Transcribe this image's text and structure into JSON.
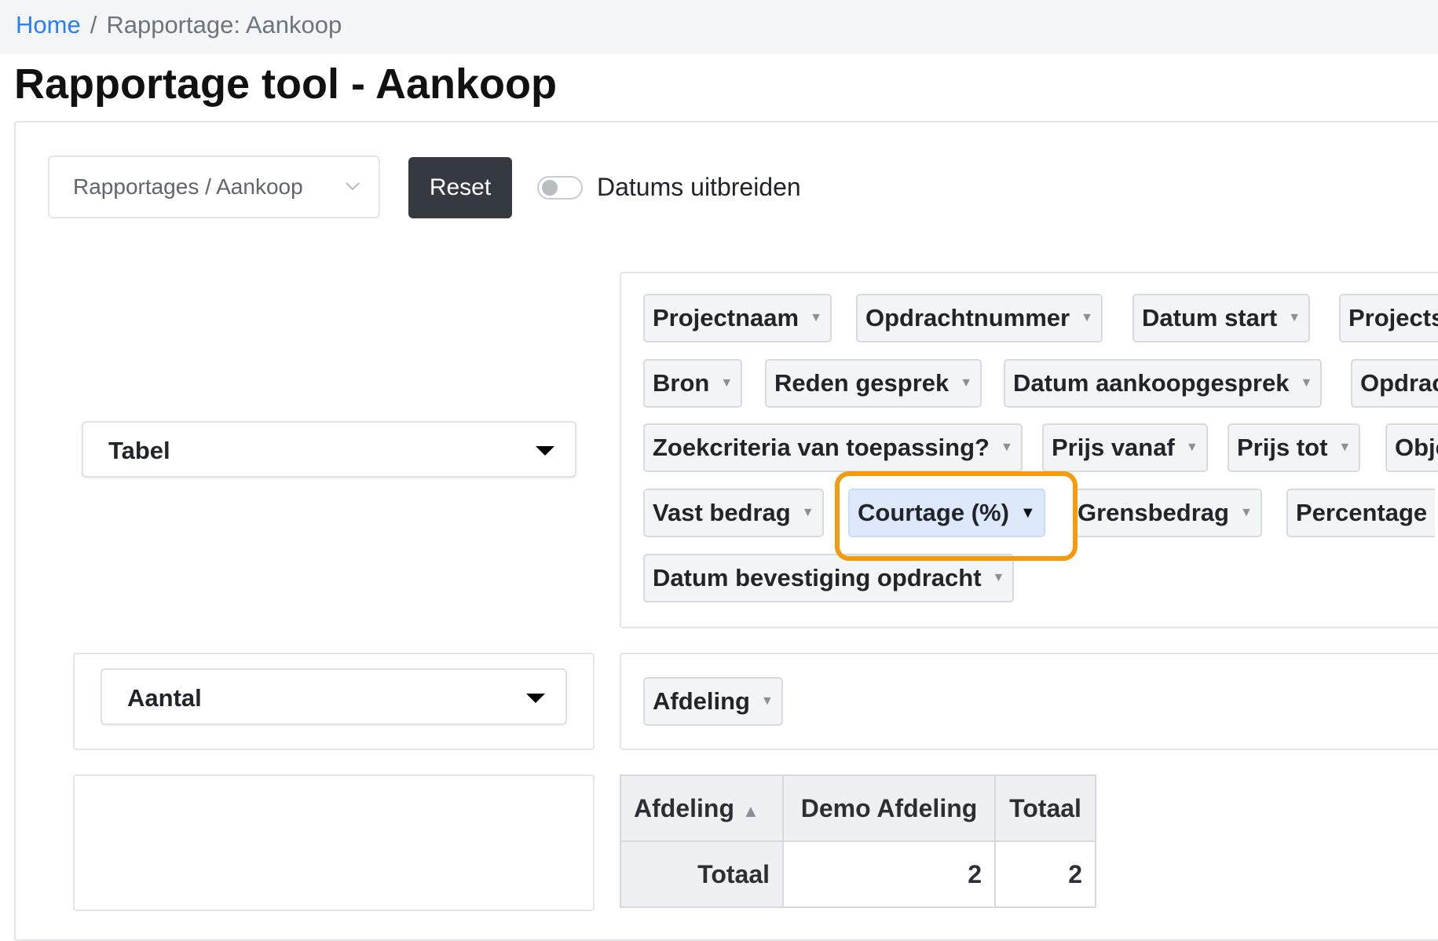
{
  "breadcrumb": {
    "home": "Home",
    "separator": "/",
    "current": "Rapportage: Aankoop"
  },
  "page": {
    "title": "Rapportage tool - Aankoop"
  },
  "toolbar": {
    "report_select_value": "Rapportages / Aankoop",
    "reset_label": "Reset",
    "toggle_label": "Datums uitbreiden",
    "toggle_on": false
  },
  "renderer": {
    "selected": "Tabel"
  },
  "aggregator": {
    "selected": "Aantal"
  },
  "attributes": [
    "Projectnaam",
    "Opdrachtnummer",
    "Datum start",
    "Projects",
    "Bron",
    "Reden gesprek",
    "Datum aankoopgesprek",
    "Opdrac",
    "Zoekcriteria van toepassing?",
    "Prijs vanaf",
    "Prijs tot",
    "Obje",
    "Vast bedrag",
    "Courtage (%)",
    "Grensbedrag",
    "Percentage",
    "Datum bevestiging opdracht"
  ],
  "selected_attribute": "Courtage (%)",
  "column_attributes": [
    "Afdeling"
  ],
  "pivot_table": {
    "header_attr": "Afdeling",
    "columns": [
      "Demo Afdeling",
      "Totaal"
    ],
    "rows": [
      {
        "label": "Totaal",
        "values": [
          "2",
          "2"
        ]
      }
    ]
  },
  "colors": {
    "link": "#2a7ef7",
    "button_dark": "#343a40",
    "highlight": "#f39a0e",
    "chip_selected": "#dde9fb"
  },
  "icons": {
    "dropdown": "chevron-down-icon",
    "filter": "triangle-down-icon",
    "sort": "triangle-up-icon"
  }
}
